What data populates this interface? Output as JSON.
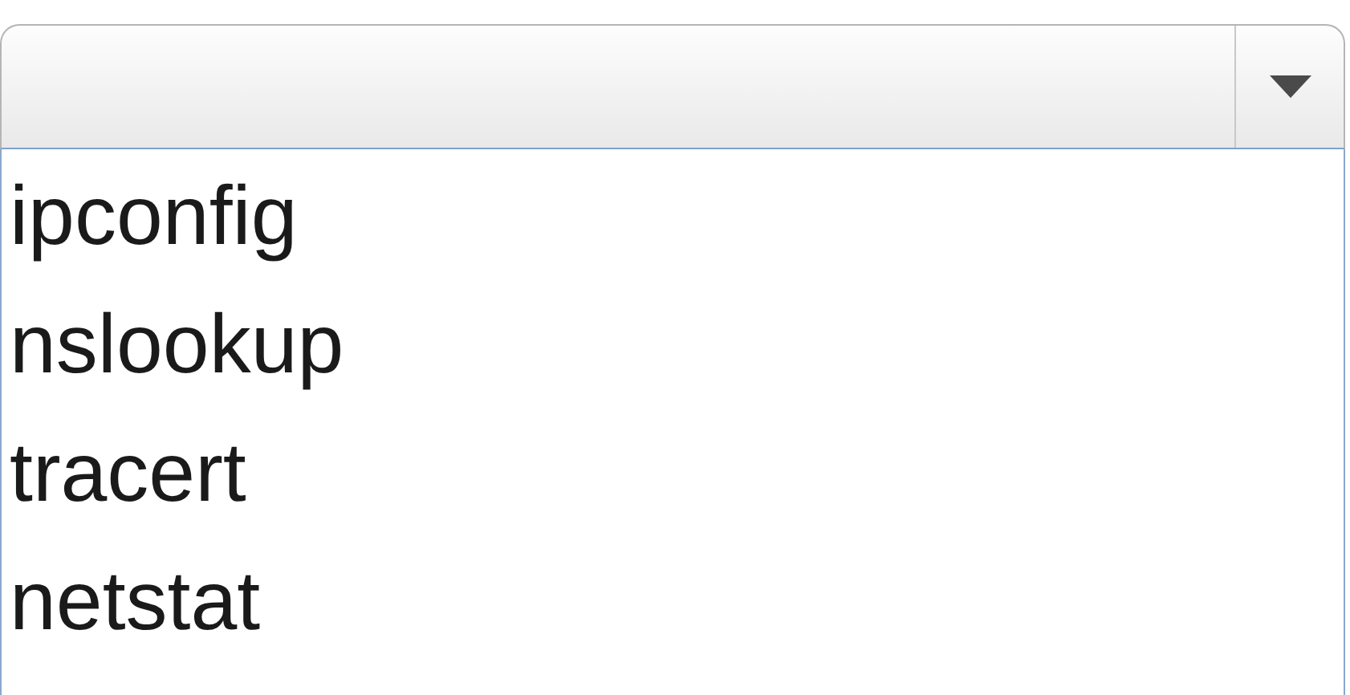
{
  "dropdown": {
    "expanded": true,
    "options": [
      {
        "label": "ipconfig",
        "selected": false
      },
      {
        "label": "nslookup",
        "selected": false
      },
      {
        "label": "tracert",
        "selected": false
      },
      {
        "label": "netstat",
        "selected": false
      }
    ]
  }
}
